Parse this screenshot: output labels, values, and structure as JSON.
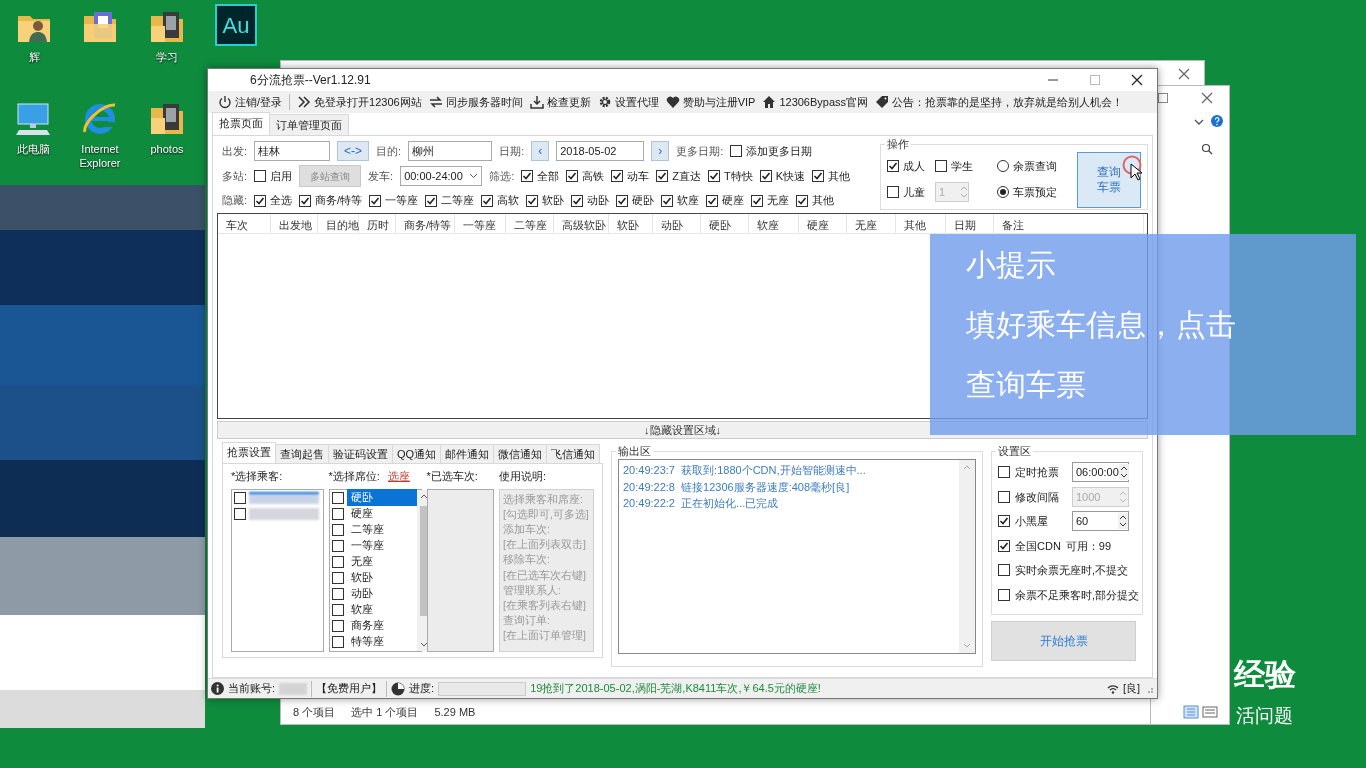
{
  "desktop_icons": [
    {
      "kind": "user-folder",
      "label": "辉"
    },
    {
      "kind": "doc-folder"
    },
    {
      "kind": "photo-folder",
      "label": "学习"
    },
    {
      "kind": "audition",
      "badge": "Au"
    },
    {
      "kind": "computer",
      "label": "此电脑"
    },
    {
      "kind": "ie",
      "label": "Internet Explorer"
    },
    {
      "kind": "photo-folder",
      "label": "photos"
    }
  ],
  "explorer": {
    "status": [
      "8 个项目",
      "选中 1 个项目",
      "5.29 MB"
    ]
  },
  "side_brand": [
    "经验",
    "活问题"
  ],
  "app": {
    "title": "6分流抢票--Ver1.12.91",
    "toolbar": [
      {
        "kind": "power",
        "label": "注销/登录"
      },
      {
        "kind": "chevrons",
        "label": "免登录打开12306网站"
      },
      {
        "kind": "sync",
        "label": "同步服务器时间"
      },
      {
        "kind": "download",
        "label": "检查更新"
      },
      {
        "kind": "gear",
        "label": "设置代理"
      },
      {
        "kind": "heart",
        "label": "赞助与注册VIP"
      },
      {
        "kind": "home",
        "label": "12306Bypass官网"
      },
      {
        "kind": "notice",
        "label": "公告：抢票靠的是坚持，放弃就是给别人机会！"
      }
    ],
    "tabs": [
      {
        "label": "抢票页面",
        "selected": true
      },
      {
        "label": "订单管理页面",
        "selected": false
      }
    ],
    "route": {
      "from_label": "出发:",
      "from": "桂林",
      "swap": "<->",
      "to_label": "目的:",
      "to": "柳州",
      "date_label": "日期:",
      "prev": "‹",
      "date": "2018-05-02",
      "next": "›",
      "more_label": "更多日期:",
      "more_dates": {
        "label": "添加更多日期",
        "checked": false
      }
    },
    "multi": {
      "label": "多站:",
      "enable": {
        "label": "启用",
        "checked": false
      },
      "button": "多站查询",
      "depart_label": "发车:",
      "depart": "00:00-24:00",
      "filter_label": "筛选:",
      "filters": [
        {
          "label": "全部",
          "checked": true
        },
        {
          "label": "高铁",
          "checked": true
        },
        {
          "label": "动车",
          "checked": true
        },
        {
          "label": "Z直达",
          "checked": true
        },
        {
          "label": "T特快",
          "checked": true
        },
        {
          "label": "K快速",
          "checked": true
        },
        {
          "label": "其他",
          "checked": true
        }
      ]
    },
    "hide": {
      "label": "隐藏:",
      "items": [
        {
          "label": "全选",
          "checked": true
        },
        {
          "label": "商务/特等",
          "checked": true
        },
        {
          "label": "一等座",
          "checked": true
        },
        {
          "label": "二等座",
          "checked": true
        },
        {
          "label": "高软",
          "checked": true
        },
        {
          "label": "软卧",
          "checked": true
        },
        {
          "label": "动卧",
          "checked": true
        },
        {
          "label": "硬卧",
          "checked": true
        },
        {
          "label": "软座",
          "checked": true
        },
        {
          "label": "硬座",
          "checked": true
        },
        {
          "label": "无座",
          "checked": true
        },
        {
          "label": "其他",
          "checked": true
        }
      ]
    },
    "operation": {
      "title": "操作",
      "adult": {
        "label": "成人",
        "checked": true
      },
      "student": {
        "label": "学生",
        "checked": false
      },
      "child": {
        "label": "儿童",
        "checked": false
      },
      "child_count": "1",
      "modes": [
        {
          "label": "余票查询",
          "selected": false
        },
        {
          "label": "车票预定",
          "selected": true
        }
      ],
      "query_button": [
        "查询",
        "车票"
      ]
    },
    "columns": [
      "车次",
      "出发地",
      "目的地",
      "历时",
      "商务/特等",
      "一等座",
      "二等座",
      "高级软卧",
      "软卧",
      "动卧",
      "硬卧",
      "软座",
      "硬座",
      "无座",
      "其他",
      "日期",
      "备注"
    ],
    "collapse": "↓隐藏设置区域↓",
    "bottom_tabs": [
      {
        "label": "抢票设置",
        "selected": true
      },
      {
        "label": "查询起售",
        "selected": false
      },
      {
        "label": "验证码设置",
        "selected": false
      },
      {
        "label": "QQ通知",
        "selected": false
      },
      {
        "label": "邮件通知",
        "selected": false
      },
      {
        "label": "微信通知",
        "selected": false
      },
      {
        "label": "飞信通知",
        "selected": false
      }
    ],
    "passengers_label": "*选择乘客:",
    "passengers": [
      {
        "checked": false,
        "selected": true
      },
      {
        "checked": false,
        "selected": false
      }
    ],
    "seats_label": "*选择席位:",
    "seat_link": "选座",
    "seats": [
      {
        "label": "硬卧",
        "checked": false,
        "selected": true
      },
      {
        "label": "硬座",
        "checked": false,
        "selected": false
      },
      {
        "label": "二等座",
        "checked": false,
        "selected": false
      },
      {
        "label": "一等座",
        "checked": false,
        "selected": false
      },
      {
        "label": "无座",
        "checked": false,
        "selected": false
      },
      {
        "label": "软卧",
        "checked": false,
        "selected": false
      },
      {
        "label": "动卧",
        "checked": false,
        "selected": false
      },
      {
        "label": "软座",
        "checked": false,
        "selected": false
      },
      {
        "label": "商务座",
        "checked": false,
        "selected": false
      },
      {
        "label": "特等座",
        "checked": false,
        "selected": false
      }
    ],
    "trains_label": "*已选车次:",
    "help_label": "使用说明:",
    "help_lines": [
      "选择乘客和席座:",
      "[勾选即可,可多选]",
      "添加车次:",
      "[在上面列表双击]",
      "移除车次:",
      "[在已选车次右键]",
      "管理联系人:",
      "[在乘客列表右键]",
      "查询订单:",
      "[在上面订单管理]"
    ],
    "output": {
      "title": "输出区",
      "log": [
        {
          "time": "20:49:23:7",
          "text": "获取到:1880个CDN,开始智能测速中..."
        },
        {
          "time": "20:49:22:8",
          "text": "链接12306服务器速度:408毫秒[良]"
        },
        {
          "time": "20:49:22:2",
          "text": "正在初始化...已完成"
        }
      ]
    },
    "settings": {
      "title": "设置区",
      "rows": [
        {
          "kind": "spin",
          "label": "定时抢票",
          "checked": false,
          "value": "06:00:00",
          "disabled": false
        },
        {
          "kind": "spin",
          "label": "修改间隔",
          "checked": false,
          "value": "1000",
          "disabled": true
        },
        {
          "kind": "spin",
          "label": "小黑屋",
          "checked": true,
          "value": "60",
          "disabled": false
        },
        {
          "kind": "info",
          "label": "全国CDN",
          "checked": true,
          "info": "可用：99"
        },
        {
          "kind": "check",
          "label": "实时余票无座时,不提交",
          "checked": false
        },
        {
          "kind": "check",
          "label": "余票不足乘客时,部分提交",
          "checked": false
        }
      ],
      "start_button": "开始抢票"
    },
    "status": {
      "account_label": "当前账号:",
      "user_type": "【免费用户】",
      "progress_label": "进度:",
      "progress": {
        "level": 0
      },
      "message": "19抢到了2018-05-02,涡阳-芜湖,K8411车次,￥64.5元的硬座!",
      "network": "[良]"
    }
  },
  "tip": {
    "title": "小提示",
    "lines": [
      "填好乘车信息，点击",
      "查询车票"
    ]
  }
}
